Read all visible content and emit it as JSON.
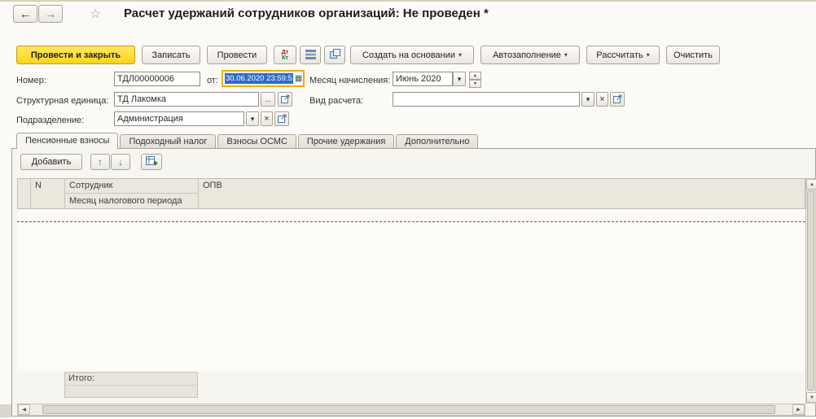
{
  "window": {
    "title": "Расчет удержаний сотрудников организаций: Не проведен *"
  },
  "icons": {
    "back": "←",
    "forward": "→",
    "star": "☆",
    "dropdown": "▾",
    "clear": "×",
    "choose": "...",
    "calendar": "▦",
    "spin_up": "▲",
    "spin_down": "▼",
    "move_up": "↑",
    "move_down": "↓",
    "scroll_left": "◀",
    "scroll_right": "▶",
    "scroll_up": "▲",
    "scroll_down": "▼",
    "dt": "Дт",
    "kt": "Кт"
  },
  "toolbar": {
    "post_and_close": "Провести и закрыть",
    "write": "Записать",
    "post": "Провести",
    "create_on_basis": "Создать на основании",
    "autofill": "Автозаполнение",
    "calculate": "Рассчитать",
    "clear": "Очистить"
  },
  "fields": {
    "number": {
      "label": "Номер:",
      "value": "ТДЛ00000006"
    },
    "date": {
      "label": "от:",
      "value": "30.06.2020 23:59:5"
    },
    "accrual_month": {
      "label": "Месяц начисления:",
      "value": "Июнь 2020"
    },
    "structural_unit": {
      "label": "Структурная единица:",
      "value": "ТД Лакомка"
    },
    "calculation_kind": {
      "label": "Вид расчета:",
      "value": ""
    },
    "department": {
      "label": "Подразделение:",
      "value": "Администрация"
    }
  },
  "tabs": {
    "items": [
      {
        "label": "Пенсионные взносы",
        "active": true
      },
      {
        "label": "Подоходный налог",
        "active": false
      },
      {
        "label": "Взносы ОСМС",
        "active": false
      },
      {
        "label": "Прочие удержания",
        "active": false
      },
      {
        "label": "Дополнительно",
        "active": false
      }
    ]
  },
  "grid": {
    "add_button": "Добавить",
    "columns": {
      "n": "N",
      "employee": "Сотрудник",
      "tax_period_month": "Месяц налогового периода",
      "opv": "ОПВ"
    },
    "footer": {
      "total": "Итого:"
    }
  }
}
